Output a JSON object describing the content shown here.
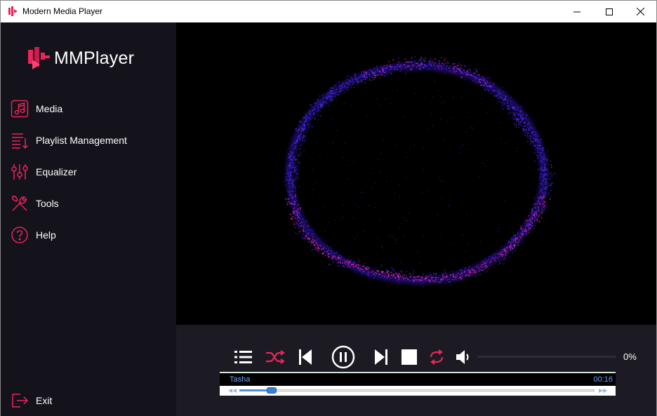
{
  "window": {
    "title": "Modern Media Player"
  },
  "brand": {
    "name": "MMPlayer",
    "accent": "#e8265a"
  },
  "nav": [
    {
      "label": "Media",
      "icon": "music-note-icon"
    },
    {
      "label": "Playlist Management",
      "icon": "playlist-icon"
    },
    {
      "label": "Equalizer",
      "icon": "equalizer-icon"
    },
    {
      "label": "Tools",
      "icon": "tools-icon"
    },
    {
      "label": "Help",
      "icon": "help-icon"
    }
  ],
  "exit": {
    "label": "Exit",
    "icon": "exit-icon"
  },
  "player": {
    "volume_label": "0%",
    "volume": 0,
    "track_name": "Tasha",
    "time": "00:16",
    "progress": 0.09
  },
  "colors": {
    "accent": "#e8265a",
    "visualizer_blue": "#3b1cff",
    "visualizer_pink": "#ff2fd0",
    "time_text": "#6aa3ff"
  }
}
